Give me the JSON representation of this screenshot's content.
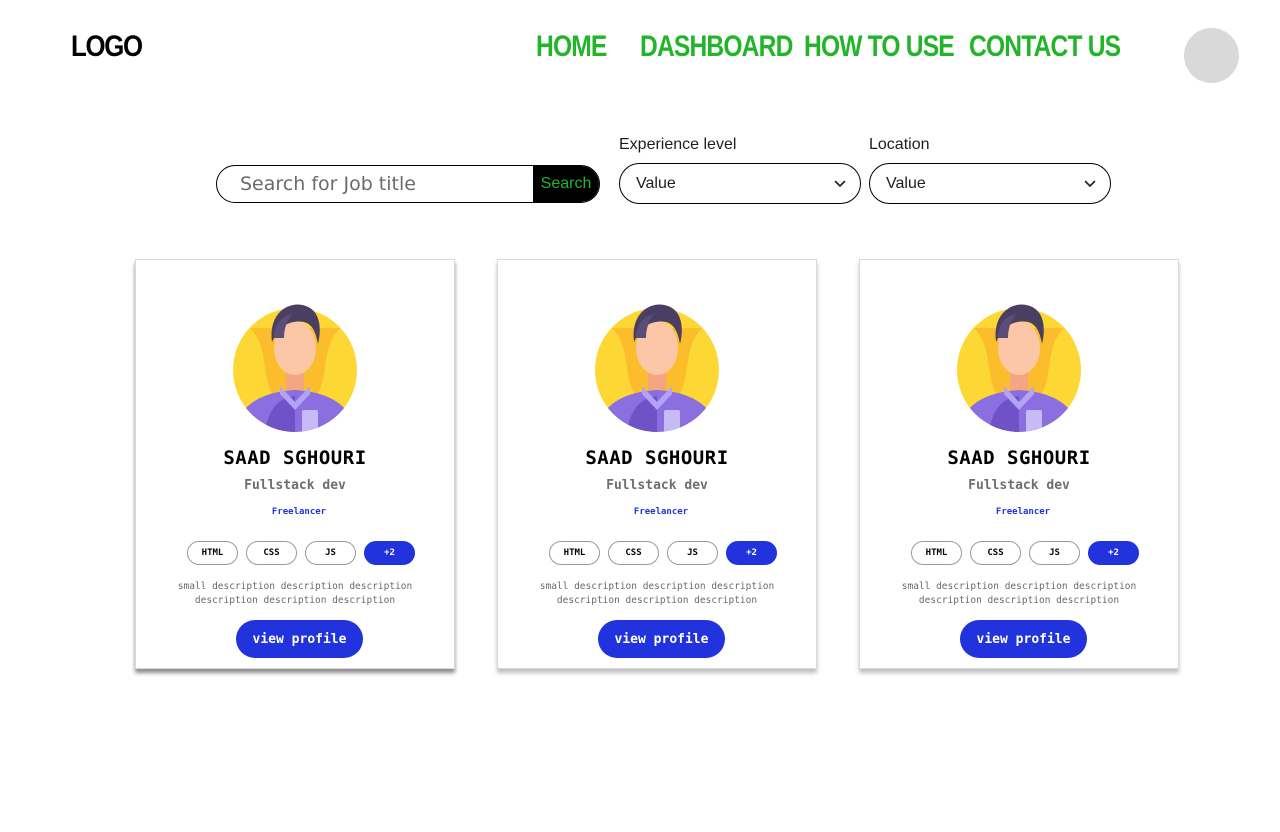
{
  "header": {
    "logo": "LOGO",
    "nav": [
      {
        "label": "HOME"
      },
      {
        "label": "DASHBOARD"
      },
      {
        "label": "HOW TO USE"
      },
      {
        "label": "CONTACT US"
      }
    ]
  },
  "search": {
    "placeholder": "Search for Job title",
    "button_label": "Search"
  },
  "filters": {
    "experience": {
      "label": "Experience level",
      "value": "Value"
    },
    "location": {
      "label": "Location",
      "value": "Value"
    }
  },
  "cards": [
    {
      "name": "SAAD SGHOURI",
      "role": "Fullstack dev",
      "type": "Freelancer",
      "tags": [
        "HTML",
        "CSS",
        "JS",
        "+2"
      ],
      "description": "small description description description description description description",
      "button_label": "view profile"
    },
    {
      "name": "SAAD SGHOURI",
      "role": "Fullstack dev",
      "type": "Freelancer",
      "tags": [
        "HTML",
        "CSS",
        "JS",
        "+2"
      ],
      "description": "small description description description description description description",
      "button_label": "view profile"
    },
    {
      "name": "SAAD SGHOURI",
      "role": "Fullstack dev",
      "type": "Freelancer",
      "tags": [
        "HTML",
        "CSS",
        "JS",
        "+2"
      ],
      "description": "small description description description description description description",
      "button_label": "view profile"
    }
  ],
  "colors": {
    "nav_green": "#22b52a",
    "accent_blue": "#2233dd",
    "avatar_placeholder": "#d9d9d9"
  }
}
